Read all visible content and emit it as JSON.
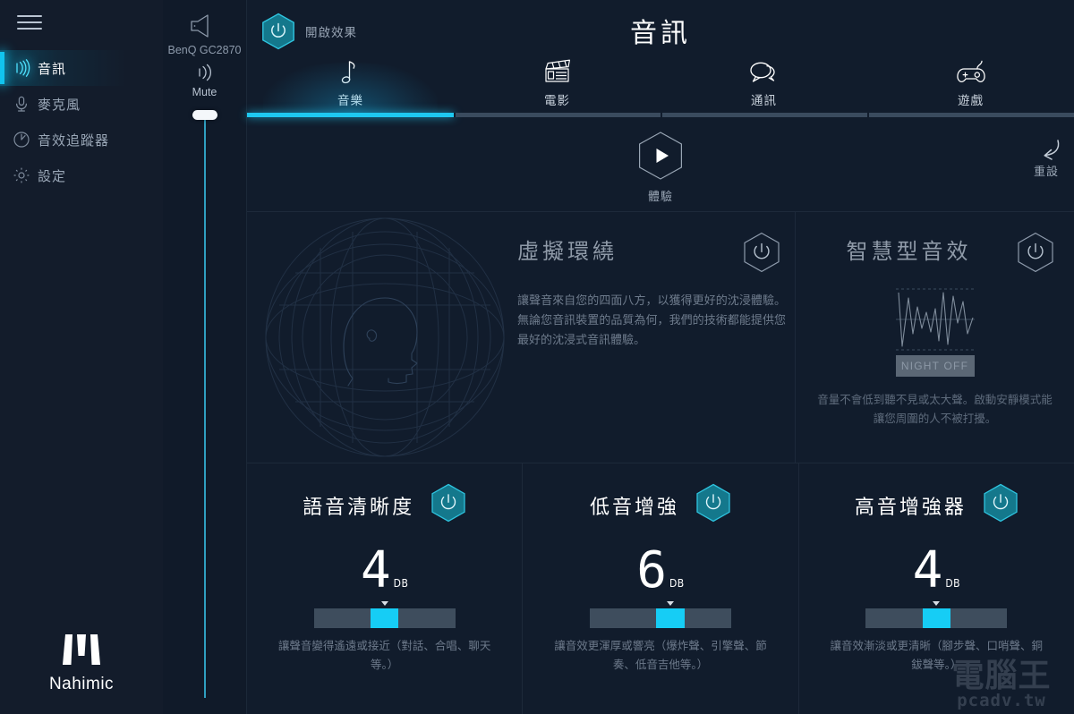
{
  "sidebar": {
    "menu_icon": "hamburger-icon",
    "items": [
      {
        "label": "音訊",
        "icon": "sound-waves-icon",
        "active": true
      },
      {
        "label": "麥克風",
        "icon": "microphone-icon",
        "active": false
      },
      {
        "label": "音效追蹤器",
        "icon": "sound-tracker-icon",
        "active": false
      },
      {
        "label": "設定",
        "icon": "gear-icon",
        "active": false
      }
    ],
    "brand": "Nahimic"
  },
  "device": {
    "speaker_icon": "speaker-icon",
    "name": "BenQ GC2870",
    "mute_icon": "mute-waves-icon",
    "mute_label": "Mute",
    "volume_percent": 92
  },
  "header": {
    "effects_toggle_label": "開啟效果",
    "effects_toggle_on": true,
    "title": "音訊"
  },
  "tabs": [
    {
      "label": "音樂",
      "icon": "music-note-icon",
      "active": true
    },
    {
      "label": "電影",
      "icon": "clapperboard-icon",
      "active": false
    },
    {
      "label": "通訊",
      "icon": "speech-bubbles-icon",
      "active": false
    },
    {
      "label": "遊戲",
      "icon": "gamepad-icon",
      "active": false
    }
  ],
  "actions": {
    "demo_label": "體驗",
    "demo_icon": "play-icon",
    "reset_label": "重設",
    "reset_icon": "undo-arrow-icon"
  },
  "virtual_surround": {
    "title": "虛擬環繞",
    "toggle_on": false,
    "toggle_icon": "power-icon",
    "description": "讓聲音來自您的四面八方，以獲得更好的沈浸體驗。無論您音訊裝置的品質為何，我們的技術都能提供您最好的沈浸式音訊體驗。"
  },
  "smart_audio": {
    "title": "智慧型音效",
    "toggle_on": false,
    "toggle_icon": "power-icon",
    "night_button": "NIGHT OFF",
    "description": "音量不會低到聽不見或太大聲。啟動安靜模式能讓您周圍的人不被打擾。"
  },
  "cards": [
    {
      "title": "語音清晰度",
      "toggle_on": true,
      "toggle_icon": "power-icon",
      "value": "4",
      "unit": "DB",
      "slider_percent": 50,
      "description": "讓聲音變得遙遠或接近（對話、合唱、聊天等。）"
    },
    {
      "title": "低音增強",
      "toggle_on": true,
      "toggle_icon": "power-icon",
      "value": "6",
      "unit": "DB",
      "slider_percent": 57,
      "description": "讓音效更渾厚或響亮（爆炸聲、引擎聲、節奏、低音吉他等。）"
    },
    {
      "title": "高音增強器",
      "toggle_on": true,
      "toggle_icon": "power-icon",
      "value": "4",
      "unit": "DB",
      "slider_percent": 50,
      "description": "讓音效漸淡或更清晰（腳步聲、口哨聲、銅鈸聲等。）"
    }
  ],
  "watermark": {
    "cn": "電腦王",
    "url": "pcadv.tw"
  },
  "colors": {
    "accent_cyan": "#16cdf5",
    "accent_teal": "#147c8f",
    "bg_dark": "#111c2c",
    "sidebar_bg": "#131c2b"
  }
}
